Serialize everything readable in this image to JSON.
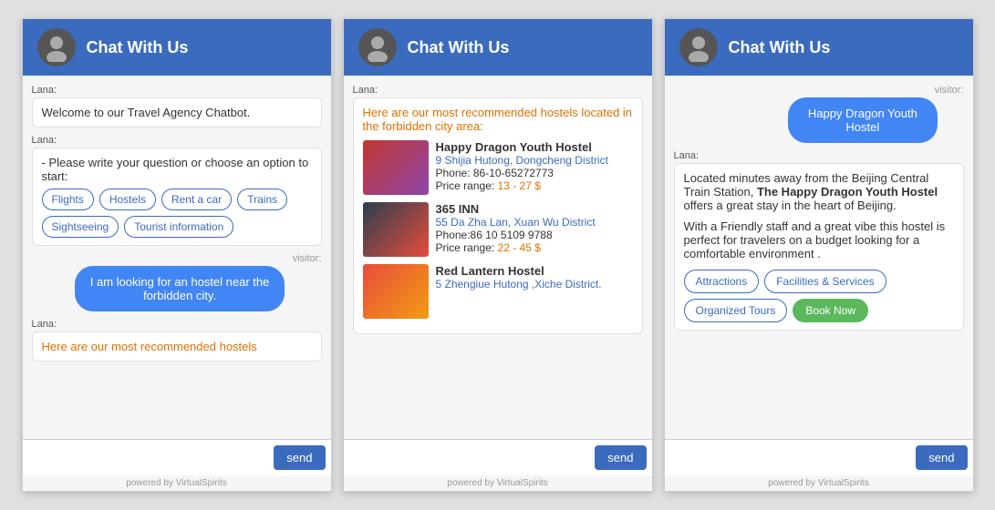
{
  "header": {
    "title": "Chat With Us"
  },
  "widget1": {
    "messages": [
      {
        "sender": "lana",
        "text": "Welcome to our Travel Agency Chatbot."
      },
      {
        "sender": "lana",
        "text": "- Please write your question or choose an option to start:",
        "options": [
          "Flights",
          "Hostels",
          "Rent a car",
          "Trains",
          "Sightseeing",
          "Tourist information"
        ]
      },
      {
        "sender": "visitor",
        "text": "I am looking for an hostel near the forbidden city."
      },
      {
        "sender": "lana",
        "text": "Here are our most recommended hostels"
      }
    ],
    "input_placeholder": "",
    "send_label": "send",
    "powered_by": "powered by VirtualSpirits"
  },
  "widget2": {
    "label_lana": "Lana:",
    "intro_text": "Here are our most recommended hostels located in the forbidden city area:",
    "hostels": [
      {
        "name": "Happy Dragon Youth Hostel",
        "address": "9 Shijia Hutong, Dongcheng District",
        "phone": "Phone: 86-10-65272773",
        "price_label": "Price range:",
        "price_value": "13 - 27 $",
        "color": "#e07000"
      },
      {
        "name": "365 INN",
        "address": "55 Da Zha Lan, Xuan Wu District",
        "phone": "Phone:86 10 5109 9788",
        "price_label": "Price range:",
        "price_value": "22 - 45 $",
        "color": "#e07000"
      },
      {
        "name": "Red Lantern Hostel",
        "address": "5 Zhengiue Hutong ,Xiche District.",
        "phone": "",
        "price_label": "",
        "price_value": "",
        "color": "#e07000"
      }
    ],
    "send_label": "send",
    "powered_by": "powered by VirtualSpirits"
  },
  "widget3": {
    "label_visitor": "visitor:",
    "visitor_msg": "Happy Dragon Youth Hostel",
    "label_lana": "Lana:",
    "description_parts": [
      {
        "plain": "Located minutes away from the Beijing Central Train Station, ",
        "bold": "The Happy Dragon Youth Hostel",
        "plain2": " offers a great stay in the heart of Beijing."
      },
      {
        "text": "With a Friendly staff and a great vibe this hostel is perfect for travelers on a budget looking for a comfortable environment ."
      }
    ],
    "action_buttons": [
      "Attractions",
      "Facilities & Services",
      "Organized Tours"
    ],
    "book_now_label": "Book Now",
    "send_label": "send",
    "powered_by": "powered by VirtualSpirits"
  },
  "icons": {
    "chat_bubble": "💬"
  }
}
